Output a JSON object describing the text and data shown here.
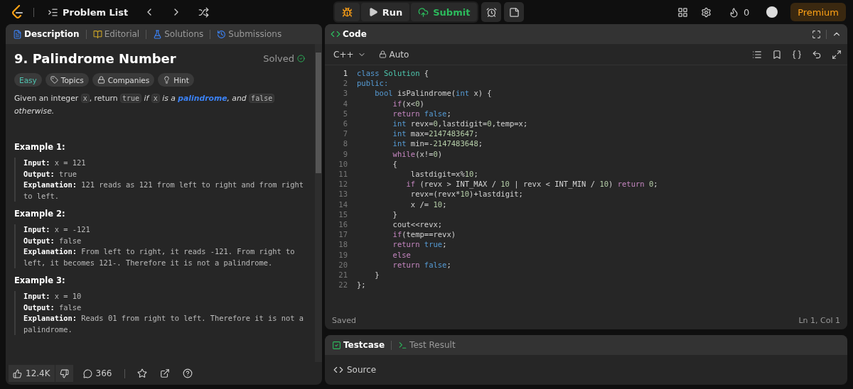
{
  "nav": {
    "problem_list": "Problem List",
    "run": "Run",
    "submit": "Submit",
    "streak": "0",
    "premium": "Premium"
  },
  "left_tabs": [
    {
      "label": "Description",
      "selected": true
    },
    {
      "label": "Editorial",
      "selected": false
    },
    {
      "label": "Solutions",
      "selected": false
    },
    {
      "label": "Submissions",
      "selected": false
    }
  ],
  "problem": {
    "title": "9. Palindrome Number",
    "status": "Solved",
    "difficulty": "Easy",
    "chips": [
      "Topics",
      "Companies",
      "Hint"
    ],
    "description": [
      {
        "text": "Given an integer ",
        "kind": "plain"
      },
      {
        "text": "x",
        "kind": "code"
      },
      {
        "text": ", return ",
        "kind": "plain"
      },
      {
        "text": "true",
        "kind": "code"
      },
      {
        "text": " if ",
        "kind": "italic"
      },
      {
        "text": "x",
        "kind": "code"
      },
      {
        "text": " is a ",
        "kind": "italic"
      },
      {
        "text": "palindrome",
        "kind": "link"
      },
      {
        "text": ", and ",
        "kind": "italic"
      },
      {
        "text": "false",
        "kind": "code"
      },
      {
        "text": " otherwise.",
        "kind": "italic"
      }
    ],
    "examples": [
      {
        "title": "Example 1:",
        "lines": [
          {
            "label": "Input:",
            "value": "x = 121"
          },
          {
            "label": "Output:",
            "value": "true"
          },
          {
            "label": "Explanation:",
            "value": "121 reads as 121 from left to right and from right to left."
          }
        ]
      },
      {
        "title": "Example 2:",
        "lines": [
          {
            "label": "Input:",
            "value": "x = -121"
          },
          {
            "label": "Output:",
            "value": "false"
          },
          {
            "label": "Explanation:",
            "value": "From left to right, it reads -121. From right to left, it becomes 121-. Therefore it is not a palindrome."
          }
        ]
      },
      {
        "title": "Example 3:",
        "lines": [
          {
            "label": "Input:",
            "value": "x = 10"
          },
          {
            "label": "Output:",
            "value": "false"
          },
          {
            "label": "Explanation:",
            "value": "Reads 01 from right to left. Therefore it is not a palindrome."
          }
        ]
      }
    ]
  },
  "footer": {
    "likes": "12.4K",
    "comments": "366"
  },
  "code_panel": {
    "title": "Code",
    "language": "C++",
    "mode": "Auto",
    "saved": "Saved",
    "cursor": "Ln 1, Col 1",
    "lines": [
      {
        "number": "1",
        "tokens": [
          {
            "text": "class ",
            "kind": "type"
          },
          {
            "text": "Solution",
            "kind": "cls"
          },
          {
            "text": " {",
            "kind": "plain"
          }
        ]
      },
      {
        "number": "2",
        "tokens": [
          {
            "text": "public:",
            "kind": "type"
          }
        ]
      },
      {
        "number": "3",
        "tokens": [
          {
            "text": "    bool",
            "kind": "type"
          },
          {
            "text": " isPalindrome(",
            "kind": "plain"
          },
          {
            "text": "int",
            "kind": "type"
          },
          {
            "text": " x) {",
            "kind": "plain"
          }
        ]
      },
      {
        "number": "4",
        "tokens": [
          {
            "text": "        if",
            "kind": "kw"
          },
          {
            "text": "(x<",
            "kind": "plain"
          },
          {
            "text": "0",
            "kind": "num"
          },
          {
            "text": ")",
            "kind": "plain"
          }
        ]
      },
      {
        "number": "5",
        "tokens": [
          {
            "text": "        return ",
            "kind": "kw"
          },
          {
            "text": "false",
            "kind": "type"
          },
          {
            "text": ";",
            "kind": "plain"
          }
        ]
      },
      {
        "number": "6",
        "tokens": [
          {
            "text": "        int",
            "kind": "type"
          },
          {
            "text": " revx=",
            "kind": "plain"
          },
          {
            "text": "0",
            "kind": "num"
          },
          {
            "text": ",lastdigit=",
            "kind": "plain"
          },
          {
            "text": "0",
            "kind": "num"
          },
          {
            "text": ",temp=x;",
            "kind": "plain"
          }
        ]
      },
      {
        "number": "7",
        "tokens": [
          {
            "text": "        int",
            "kind": "type"
          },
          {
            "text": " max=",
            "kind": "plain"
          },
          {
            "text": "2147483647",
            "kind": "num"
          },
          {
            "text": ";",
            "kind": "plain"
          }
        ]
      },
      {
        "number": "8",
        "tokens": [
          {
            "text": "        int",
            "kind": "type"
          },
          {
            "text": " min=-",
            "kind": "plain"
          },
          {
            "text": "2147483648",
            "kind": "num"
          },
          {
            "text": ";",
            "kind": "plain"
          }
        ]
      },
      {
        "number": "9",
        "tokens": [
          {
            "text": "        while",
            "kind": "kw"
          },
          {
            "text": "(x!=",
            "kind": "plain"
          },
          {
            "text": "0",
            "kind": "num"
          },
          {
            "text": ")",
            "kind": "plain"
          }
        ]
      },
      {
        "number": "10",
        "tokens": [
          {
            "text": "        {",
            "kind": "plain"
          }
        ]
      },
      {
        "number": "11",
        "tokens": [
          {
            "text": "            lastdigit=x%",
            "kind": "plain"
          },
          {
            "text": "10",
            "kind": "num"
          },
          {
            "text": ";",
            "kind": "plain"
          }
        ]
      },
      {
        "number": "12",
        "tokens": [
          {
            "text": "           if",
            "kind": "kw"
          },
          {
            "text": " (revx > INT_MAX / ",
            "kind": "plain"
          },
          {
            "text": "10",
            "kind": "num"
          },
          {
            "text": " | revx < INT_MIN / ",
            "kind": "plain"
          },
          {
            "text": "10",
            "kind": "num"
          },
          {
            "text": ") ",
            "kind": "plain"
          },
          {
            "text": "return ",
            "kind": "kw"
          },
          {
            "text": "0",
            "kind": "num"
          },
          {
            "text": ";",
            "kind": "plain"
          }
        ]
      },
      {
        "number": "13",
        "tokens": [
          {
            "text": "            revx=(revx*",
            "kind": "plain"
          },
          {
            "text": "10",
            "kind": "num"
          },
          {
            "text": ")+lastdigit;",
            "kind": "plain"
          }
        ]
      },
      {
        "number": "14",
        "tokens": [
          {
            "text": "            x /= ",
            "kind": "plain"
          },
          {
            "text": "10",
            "kind": "num"
          },
          {
            "text": ";",
            "kind": "plain"
          }
        ]
      },
      {
        "number": "15",
        "tokens": [
          {
            "text": "        }",
            "kind": "plain"
          }
        ]
      },
      {
        "number": "16",
        "tokens": [
          {
            "text": "        cout<<revx;",
            "kind": "plain"
          }
        ]
      },
      {
        "number": "17",
        "tokens": [
          {
            "text": "        if",
            "kind": "kw"
          },
          {
            "text": "(temp==revx)",
            "kind": "plain"
          }
        ]
      },
      {
        "number": "18",
        "tokens": [
          {
            "text": "        return ",
            "kind": "kw"
          },
          {
            "text": "true",
            "kind": "type"
          },
          {
            "text": ";",
            "kind": "plain"
          }
        ]
      },
      {
        "number": "19",
        "tokens": [
          {
            "text": "        else",
            "kind": "kw"
          }
        ]
      },
      {
        "number": "20",
        "tokens": [
          {
            "text": "        return ",
            "kind": "kw"
          },
          {
            "text": "false",
            "kind": "type"
          },
          {
            "text": ";",
            "kind": "plain"
          }
        ]
      },
      {
        "number": "21",
        "tokens": [
          {
            "text": "    }",
            "kind": "plain"
          }
        ]
      },
      {
        "number": "22",
        "tokens": [
          {
            "text": "};",
            "kind": "plain"
          }
        ]
      }
    ]
  },
  "test_tabs": [
    {
      "label": "Testcase",
      "selected": true
    },
    {
      "label": "Test Result",
      "selected": false
    }
  ],
  "source": "Source"
}
